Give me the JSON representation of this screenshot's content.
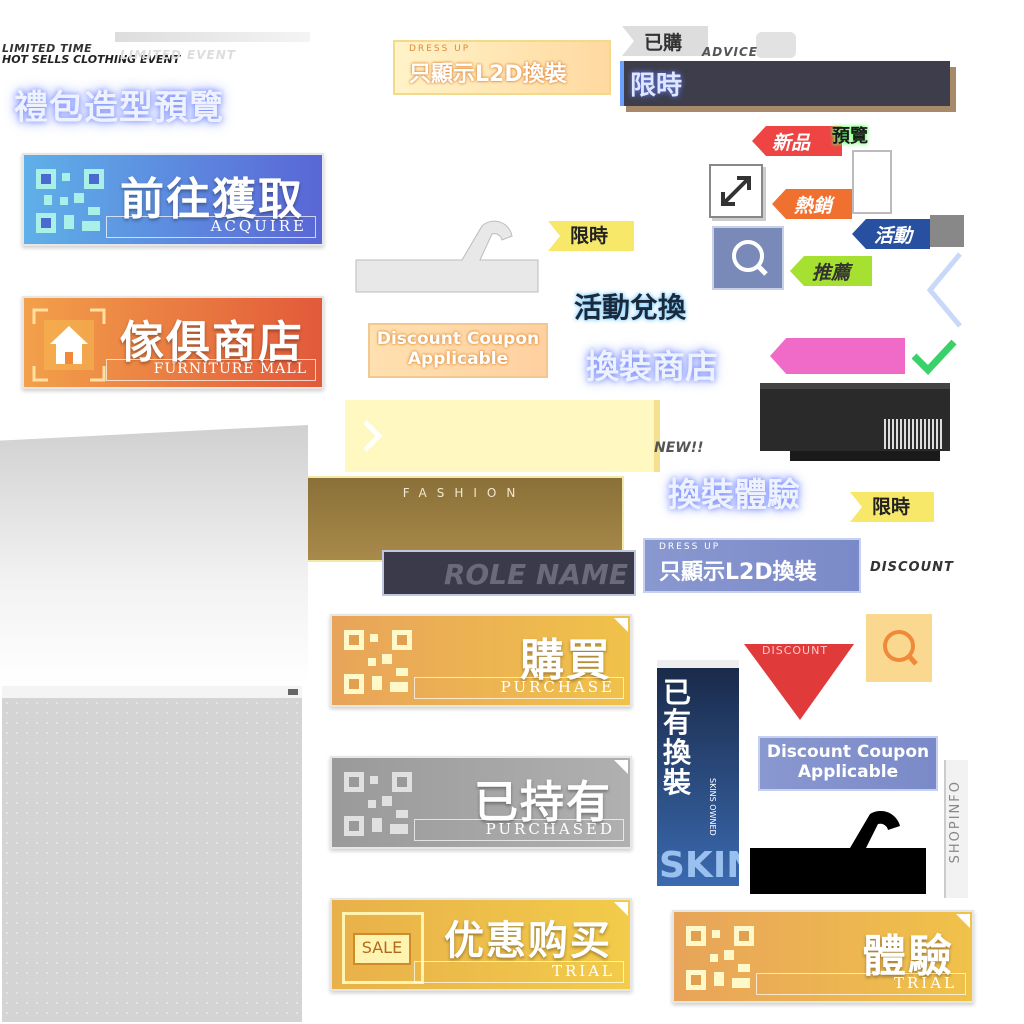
{
  "event_header": {
    "line1": "LIMITED TIME",
    "line2": "HOT SELLS CLOTHING EVENT",
    "ghost": "LIMITED EVENT",
    "gift_preview": "禮包造型預覽"
  },
  "dress_up_top": {
    "small": "DRESS UP",
    "label": "只顯示L2D換裝"
  },
  "dress_up_mid": {
    "small": "DRESS UP",
    "label": "只顯示L2D換裝"
  },
  "limited_bar": {
    "label": "限時"
  },
  "purchased_tag": {
    "label": "已購",
    "advice": "ADVICE"
  },
  "tags": {
    "new": "新品",
    "preview": "預覽",
    "hot": "熱銷",
    "event": "活動",
    "recommend": "推薦",
    "limited1": "限時",
    "limited2": "限時",
    "new_badge": "NEW!!"
  },
  "buttons": {
    "acquire": {
      "label": "前往獲取",
      "sub": "ACQUIRE"
    },
    "furniture": {
      "label": "傢俱商店",
      "sub": "FURNITURE MALL"
    },
    "purchase": {
      "label": "購買",
      "sub": "PURCHASE"
    },
    "owned": {
      "label": "已持有",
      "sub": "PURCHASED"
    },
    "sale": {
      "label": "优惠购买",
      "sub": "TRIAL",
      "badge": "SALE"
    },
    "trial": {
      "label": "體驗",
      "sub": "TRIAL"
    }
  },
  "coupon1": {
    "line1": "Discount Coupon",
    "line2": "Applicable"
  },
  "coupon2": {
    "line1": "Discount Coupon",
    "line2": "Applicable"
  },
  "event_exchange": "活動兌換",
  "outfit_shop": "換裝商店",
  "outfit_trial": "換裝體驗",
  "fashion_label": "FASHION",
  "role_name": "ROLE NAME",
  "discount_text": "DISCOUNT",
  "discount_triangle": "DISCOUNT",
  "skins_panel": {
    "vertical": "已有換裝",
    "small": "SKINS OWNED",
    "big": "SKINS"
  },
  "shopinfo": "SHOPINFO",
  "colors": {
    "blue_btn": "#5a66d6",
    "orange_btn": "#e25a3a",
    "gold_btn": "#f0c24a",
    "gray_btn": "#a0a0a0",
    "tag_red": "#ee4444",
    "tag_orange": "#f07030",
    "tag_blue": "#2850a0",
    "tag_green": "#a6e030",
    "yellow_chip": "#f7e86a",
    "pink": "#f06ac8",
    "check_green": "#3ad06a"
  },
  "icons": [
    "expand-icon",
    "search-icon",
    "home-icon",
    "hanger-icon",
    "check-icon",
    "chevron-right-icon",
    "close-icon"
  ]
}
